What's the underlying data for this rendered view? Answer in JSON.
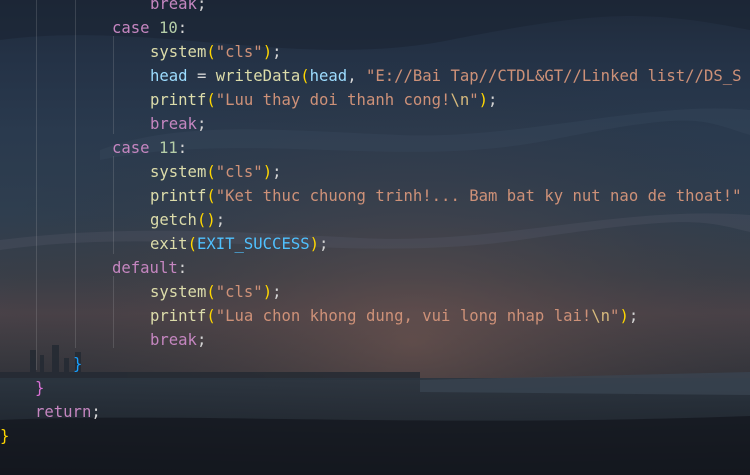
{
  "editor": {
    "lines": [
      {
        "id": "l0",
        "parts": [
          {
            "t": "break",
            "c": "kw"
          },
          {
            "t": ";",
            "c": "plain"
          }
        ]
      },
      {
        "id": "l1",
        "parts": [
          {
            "t": "case",
            "c": "kw"
          },
          {
            "t": " ",
            "c": "plain"
          },
          {
            "t": "10",
            "c": "num"
          },
          {
            "t": ":",
            "c": "plain"
          }
        ]
      },
      {
        "id": "l2",
        "parts": [
          {
            "t": "system",
            "c": "fn"
          },
          {
            "t": "(",
            "c": "p1"
          },
          {
            "t": "\"cls\"",
            "c": "str"
          },
          {
            "t": ")",
            "c": "p1"
          },
          {
            "t": ";",
            "c": "plain"
          }
        ]
      },
      {
        "id": "l3",
        "parts": [
          {
            "t": "head",
            "c": "var"
          },
          {
            "t": " = ",
            "c": "plain"
          },
          {
            "t": "writeData",
            "c": "fn"
          },
          {
            "t": "(",
            "c": "p1"
          },
          {
            "t": "head",
            "c": "var"
          },
          {
            "t": ", ",
            "c": "plain"
          },
          {
            "t": "\"E://Bai Tap//CTDL&GT//Linked list//DS_S",
            "c": "str"
          }
        ]
      },
      {
        "id": "l4",
        "parts": [
          {
            "t": "printf",
            "c": "fn"
          },
          {
            "t": "(",
            "c": "p1"
          },
          {
            "t": "\"Luu thay doi thanh cong!",
            "c": "str"
          },
          {
            "t": "\\n",
            "c": "esc"
          },
          {
            "t": "\"",
            "c": "str"
          },
          {
            "t": ")",
            "c": "p1"
          },
          {
            "t": ";",
            "c": "plain"
          }
        ]
      },
      {
        "id": "l5",
        "parts": [
          {
            "t": "break",
            "c": "kw"
          },
          {
            "t": ";",
            "c": "plain"
          }
        ]
      },
      {
        "id": "l6",
        "parts": [
          {
            "t": "case",
            "c": "kw"
          },
          {
            "t": " ",
            "c": "plain"
          },
          {
            "t": "11",
            "c": "num"
          },
          {
            "t": ":",
            "c": "plain"
          }
        ]
      },
      {
        "id": "l7",
        "parts": [
          {
            "t": "system",
            "c": "fn"
          },
          {
            "t": "(",
            "c": "p1"
          },
          {
            "t": "\"cls\"",
            "c": "str"
          },
          {
            "t": ")",
            "c": "p1"
          },
          {
            "t": ";",
            "c": "plain"
          }
        ]
      },
      {
        "id": "l8",
        "parts": [
          {
            "t": "printf",
            "c": "fn"
          },
          {
            "t": "(",
            "c": "p1"
          },
          {
            "t": "\"Ket thuc chuong trinh!... Bam bat ky nut nao de thoat!\"",
            "c": "str"
          }
        ]
      },
      {
        "id": "l9",
        "parts": [
          {
            "t": "getch",
            "c": "fn"
          },
          {
            "t": "(",
            "c": "p1"
          },
          {
            "t": ")",
            "c": "p1"
          },
          {
            "t": ";",
            "c": "plain"
          }
        ]
      },
      {
        "id": "l10",
        "parts": [
          {
            "t": "exit",
            "c": "fn"
          },
          {
            "t": "(",
            "c": "p1"
          },
          {
            "t": "EXIT_SUCCESS",
            "c": "const"
          },
          {
            "t": ")",
            "c": "p1"
          },
          {
            "t": ";",
            "c": "plain"
          }
        ]
      },
      {
        "id": "l11",
        "parts": [
          {
            "t": "default",
            "c": "kw"
          },
          {
            "t": ":",
            "c": "plain"
          }
        ]
      },
      {
        "id": "l12",
        "parts": [
          {
            "t": "system",
            "c": "fn"
          },
          {
            "t": "(",
            "c": "p1"
          },
          {
            "t": "\"cls\"",
            "c": "str"
          },
          {
            "t": ")",
            "c": "p1"
          },
          {
            "t": ";",
            "c": "plain"
          }
        ]
      },
      {
        "id": "l13",
        "parts": [
          {
            "t": "printf",
            "c": "fn"
          },
          {
            "t": "(",
            "c": "p1"
          },
          {
            "t": "\"Lua chon khong dung, vui long nhap lai!",
            "c": "str"
          },
          {
            "t": "\\n",
            "c": "esc"
          },
          {
            "t": "\"",
            "c": "str"
          },
          {
            "t": ")",
            "c": "p1"
          },
          {
            "t": ";",
            "c": "plain"
          }
        ]
      },
      {
        "id": "l14",
        "parts": [
          {
            "t": "break",
            "c": "kw"
          },
          {
            "t": ";",
            "c": "plain"
          }
        ]
      },
      {
        "id": "l15",
        "parts": [
          {
            "t": "}",
            "c": "p3"
          }
        ]
      },
      {
        "id": "l16",
        "parts": [
          {
            "t": "}",
            "c": "p2"
          }
        ]
      },
      {
        "id": "l17",
        "parts": [
          {
            "t": "return",
            "c": "kw"
          },
          {
            "t": ";",
            "c": "plain"
          }
        ]
      },
      {
        "id": "l18",
        "parts": [
          {
            "t": "}",
            "c": "p1"
          }
        ]
      }
    ]
  }
}
